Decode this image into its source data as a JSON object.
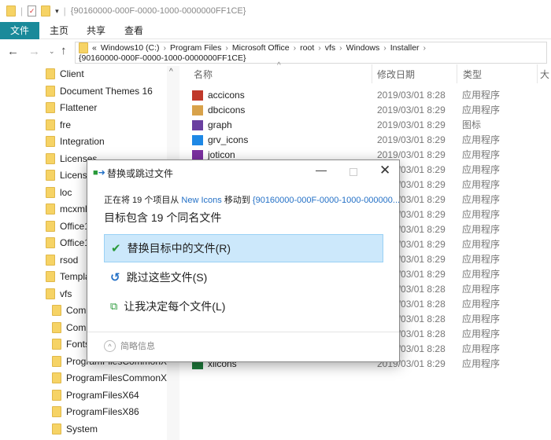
{
  "window": {
    "title": "{90160000-000F-0000-1000-0000000FF1CE}"
  },
  "ribbon": {
    "tabs": [
      "文件",
      "主页",
      "共享",
      "查看"
    ]
  },
  "address": {
    "prefix": "«",
    "crumbs": [
      "Windows10 (C:)",
      "Program Files",
      "Microsoft Office",
      "root",
      "vfs",
      "Windows",
      "Installer",
      "{90160000-000F-0000-1000-0000000FF1CE}"
    ]
  },
  "sidebar": {
    "items": [
      "Client",
      "Document Themes 16",
      "Flattener",
      "fre",
      "Integration",
      "Licenses",
      "License",
      "loc",
      "mcxml",
      "Office1",
      "Office1",
      "rsod",
      "Templa",
      "vfs",
      "Comm",
      "Comm",
      "Fonts",
      "ProgramFilesCommonX64",
      "ProgramFilesCommonX86",
      "ProgramFilesX64",
      "ProgramFilesX86",
      "System"
    ]
  },
  "columns": {
    "name": "名称",
    "date": "修改日期",
    "type": "类型",
    "size": "大"
  },
  "files": [
    {
      "name": "accicons",
      "date": "2019/03/01 8:28",
      "type": "应用程序",
      "color": "#c0392b"
    },
    {
      "name": "dbcicons",
      "date": "2019/03/01 8:29",
      "type": "应用程序",
      "color": "#d8a24a"
    },
    {
      "name": "graph",
      "date": "2019/03/01 8:29",
      "type": "图标",
      "color": "#6a3fa0"
    },
    {
      "name": "grv_icons",
      "date": "2019/03/01 8:29",
      "type": "应用程序",
      "color": "#1e88e5"
    },
    {
      "name": "joticon",
      "date": "2019/03/01 8:29",
      "type": "应用程序",
      "color": "#7b2fa0"
    },
    {
      "name": "",
      "date": "2019/03/01 8:29",
      "type": "应用程序"
    },
    {
      "name": "",
      "date": "2019/03/01 8:29",
      "type": "应用程序"
    },
    {
      "name": "",
      "date": "2019/03/01 8:29",
      "type": "应用程序"
    },
    {
      "name": "",
      "date": "2019/03/01 8:29",
      "type": "应用程序"
    },
    {
      "name": "",
      "date": "2019/03/01 8:29",
      "type": "应用程序"
    },
    {
      "name": "",
      "date": "2019/03/01 8:29",
      "type": "应用程序"
    },
    {
      "name": "",
      "date": "2019/03/01 8:29",
      "type": "应用程序"
    },
    {
      "name": "",
      "date": "2019/03/01 8:29",
      "type": "应用程序"
    },
    {
      "name": "",
      "date": "2019/03/01 8:28",
      "type": "应用程序"
    },
    {
      "name": "",
      "date": "2019/03/01 8:28",
      "type": "应用程序"
    },
    {
      "name": "",
      "date": "2019/03/01 8:28",
      "type": "应用程序"
    },
    {
      "name": "",
      "date": "2019/03/01 8:28",
      "type": "应用程序"
    },
    {
      "name": "",
      "date": "2019/03/01 8:28",
      "type": "应用程序"
    },
    {
      "name": "xlicons",
      "date": "2019/03/01 8:29",
      "type": "应用程序",
      "color": "#1e7a3c"
    }
  ],
  "dialog": {
    "title": "替换或跳过文件",
    "line_pre": "正在将 19 个项目从",
    "source": "New Icons",
    "line_mid": "移动到",
    "dest": "{90160000-000F-0000-1000-000000...",
    "heading": "目标包含 19 个同名文件",
    "options": [
      "替换目标中的文件(R)",
      "跳过这些文件(S)",
      "让我决定每个文件(L)"
    ],
    "details": "简略信息"
  },
  "colors": {
    "accent": "#1a8a9a",
    "option_highlight": "#cce8fb",
    "link": "#2370c6"
  }
}
